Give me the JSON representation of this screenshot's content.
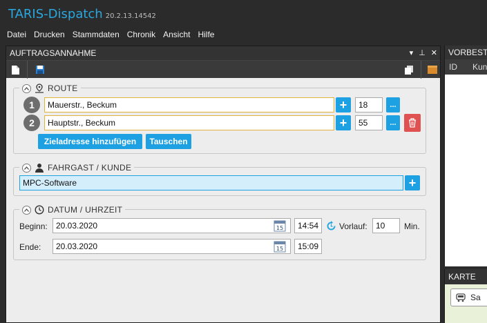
{
  "app": {
    "title": "TARIS-Dispatch",
    "version": "20.2.13.14542"
  },
  "menu": [
    "Datei",
    "Drucken",
    "Stammdaten",
    "Chronik",
    "Ansicht",
    "Hilfe"
  ],
  "panel": {
    "title": "AUFTRAGSANNAHME",
    "pin_symbol": "▾",
    "pin2_symbol": "⊥",
    "close_symbol": "✕"
  },
  "route": {
    "title": "ROUTE",
    "stops": [
      {
        "number": "1",
        "address": "Mauerstr., Beckum",
        "house_number": "18"
      },
      {
        "number": "2",
        "address": "Hauptstr., Beckum",
        "house_number": "55"
      }
    ],
    "add_destination_label": "Zieladresse hinzufügen",
    "swap_label": "Tauschen",
    "more_label": "..."
  },
  "customer": {
    "title": "FAHRGAST / KUNDE",
    "value": "MPC-Software"
  },
  "datetime": {
    "title": "DATUM / UHRZEIT",
    "begin_label": "Beginn:",
    "begin_date": "20.03.2020",
    "begin_time": "14:54",
    "lead_label": "Vorlauf:",
    "lead_value": "10",
    "lead_unit": "Min.",
    "end_label": "Ende:",
    "end_date": "20.03.2020",
    "end_time": "15:09",
    "calendar_day": "15"
  },
  "right_panel": {
    "title": "VORBESTE",
    "columns": [
      "ID",
      "Kund"
    ]
  },
  "map_panel": {
    "title": "KARTE",
    "chip_label": "Sa"
  },
  "colors": {
    "accent": "#1da1e2",
    "title_blue": "#29a8e0",
    "danger": "#e05252",
    "address_border": "#e3b23c"
  }
}
